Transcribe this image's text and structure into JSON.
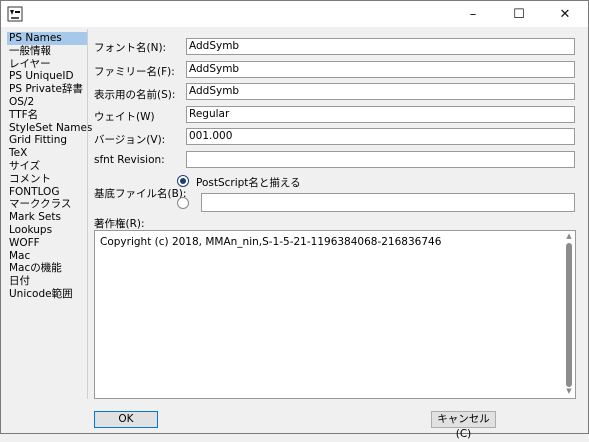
{
  "titlebar": {
    "minimize": "–",
    "maximize": "☐",
    "close": "✕"
  },
  "sidebar": {
    "items": [
      {
        "label": "PS Names",
        "selected": true
      },
      {
        "label": "一般情報"
      },
      {
        "label": "レイヤー"
      },
      {
        "label": "PS UniqueID"
      },
      {
        "label": "PS Private辞書"
      },
      {
        "label": "OS/2"
      },
      {
        "label": "TTF名"
      },
      {
        "label": "StyleSet Names"
      },
      {
        "label": "Grid Fitting"
      },
      {
        "label": "TeX"
      },
      {
        "label": "サイズ"
      },
      {
        "label": "コメント"
      },
      {
        "label": "FONTLOG"
      },
      {
        "label": "マーククラス"
      },
      {
        "label": "Mark Sets"
      },
      {
        "label": "Lookups"
      },
      {
        "label": "WOFF"
      },
      {
        "label": "Mac"
      },
      {
        "label": "Macの機能"
      },
      {
        "label": "日付"
      },
      {
        "label": "Unicode範囲"
      }
    ]
  },
  "form": {
    "fontname_label": "フォント名(N):",
    "fontname_value": "AddSymb",
    "family_label": "ファミリー名(F):",
    "family_value": "AddSymb",
    "display_label": "表示用の名前(S):",
    "display_value": "AddSymb",
    "weight_label": "ウェイト(W)",
    "weight_value": "Regular",
    "version_label": "バージョン(V):",
    "version_value": "001.000",
    "sfnt_label": "sfnt Revision:",
    "sfnt_value": "",
    "basefile_label": "基底ファイル名(B):",
    "radio_ps_label": "PostScript名と揃える",
    "radio_custom_value": "",
    "copyright_label": "著作権(R):",
    "copyright_value": "Copyright (c) 2018, MMAn_nin,S-1-5-21-1196384068-216836746"
  },
  "buttons": {
    "ok": "OK",
    "cancel": "キャンセル(C)"
  },
  "colors": {
    "selection": "#a6c8ea",
    "radio": "#1c3e75",
    "ok_border": "#0078d7"
  }
}
